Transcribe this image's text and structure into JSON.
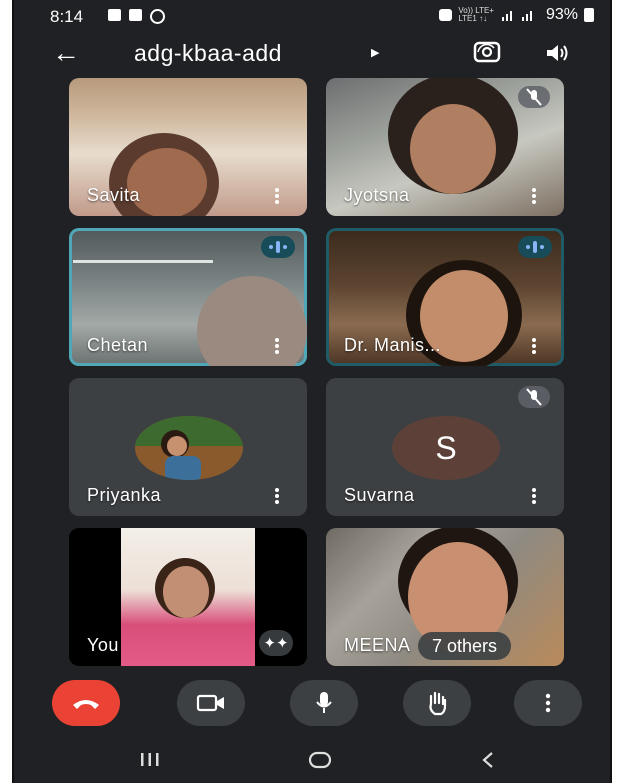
{
  "status_bar": {
    "time": "8:14",
    "network": "Vo)) LTE+\nLTE1 ↑↓",
    "battery": "93%"
  },
  "header": {
    "meeting_code": "adg-kbaa-add",
    "icons": [
      "back-arrow-icon",
      "switch-camera-icon",
      "speaker-icon"
    ]
  },
  "participants": [
    {
      "name": "Savita",
      "state": "video"
    },
    {
      "name": "Jyotsna",
      "state": "video",
      "muted": true
    },
    {
      "name": "Chetan",
      "state": "video",
      "speaking": true
    },
    {
      "name": "Dr. Manis...",
      "state": "video",
      "speaking": true
    },
    {
      "name": "Priyanka",
      "state": "avatar-photo"
    },
    {
      "name": "Suvarna",
      "state": "avatar-initial",
      "initial": "S",
      "muted": true
    },
    {
      "name": "You",
      "state": "video"
    },
    {
      "name": "MEENA",
      "state": "video",
      "others_label": "7 others"
    }
  ],
  "controls": [
    "end-call-icon",
    "camera-icon",
    "microphone-icon",
    "raise-hand-icon",
    "more-options-icon"
  ],
  "colors": {
    "background": "#202124",
    "tile": "#3c4043",
    "end_call": "#ea4335",
    "speaking_badge": "#174c58",
    "avatar_s": "#5d4037"
  }
}
